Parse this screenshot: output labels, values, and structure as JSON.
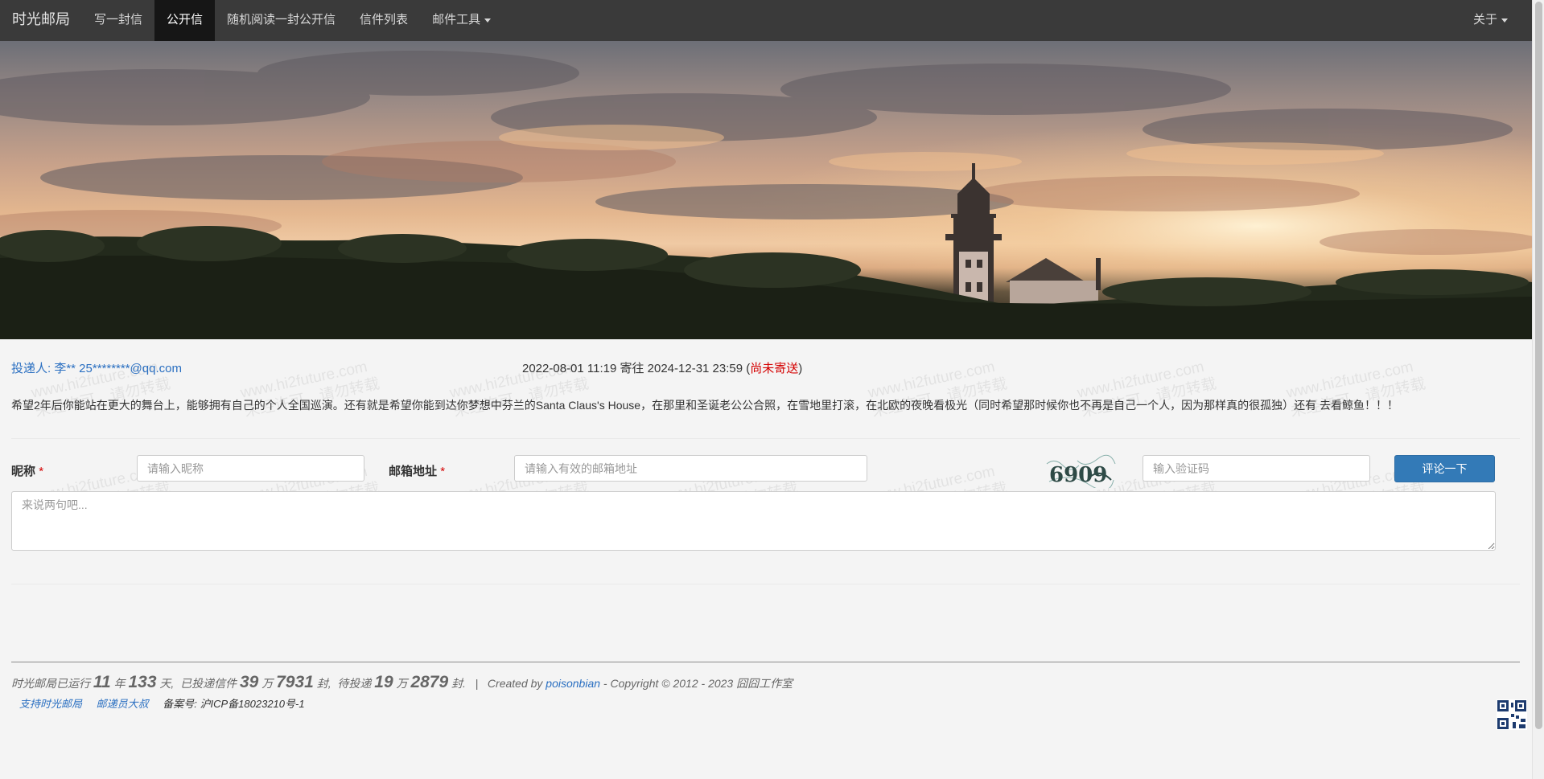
{
  "navbar": {
    "brand": "时光邮局",
    "items": [
      {
        "label": "写一封信"
      },
      {
        "label": "公开信"
      },
      {
        "label": "随机阅读一封公开信"
      },
      {
        "label": "信件列表"
      },
      {
        "label": "邮件工具"
      }
    ],
    "about": "关于"
  },
  "letter": {
    "sender": "投递人: 李** 25********@qq.com",
    "date_prefix": "2022-08-01 11:19 寄往 2024-12-31 23:59 (",
    "status": "尚未寄送",
    "date_suffix": ")",
    "body": "希望2年后你能站在更大的舞台上，能够拥有自己的个人全国巡演。还有就是希望你能到达你梦想中芬兰的Santa Claus's House，在那里和圣诞老公公合照，在雪地里打滚，在北欧的夜晚看极光（同时希望那时候你也不再是自己一个人，因为那样真的很孤独）还有 去看鲸鱼！！！"
  },
  "watermark": {
    "line1": "www.hi2future.com",
    "line2": "未经许可，请勿转载"
  },
  "form": {
    "nickname_label": "昵称",
    "nickname_placeholder": "请输入昵称",
    "email_label": "邮箱地址",
    "email_placeholder": "请输入有效的邮箱地址",
    "captcha_text": "6909",
    "captcha_placeholder": "输入验证码",
    "submit_label": "评论一下",
    "comment_placeholder": "来说两句吧...",
    "required_mark": "*"
  },
  "footer": {
    "run_prefix": "时光邮局已运行",
    "years": "11",
    "year_unit": "年",
    "days": "133",
    "day_unit": "天,",
    "sent_prefix": "已投递信件",
    "sent_wan": "39",
    "wan_unit": "万",
    "sent_rest": "7931",
    "feng_unit": "封,",
    "pending_prefix": "待投递",
    "pending_wan": "19",
    "pending_rest": "2879",
    "feng_end": "封.",
    "separator": "|",
    "created_by": "Created by",
    "author": "poisonbian",
    "copyright": "- Copyright © 2012 - 2023 囧囧工作室",
    "support_link": "支持时光邮局",
    "postman_link": "邮递员大叔",
    "icp": "备案号: 沪ICP备18023210号-1"
  },
  "colors": {
    "navbar": "#3a3a3a",
    "navbar_active": "#161616",
    "link": "#2a6fc1",
    "status_red": "#d40000",
    "button": "#337ab7"
  }
}
